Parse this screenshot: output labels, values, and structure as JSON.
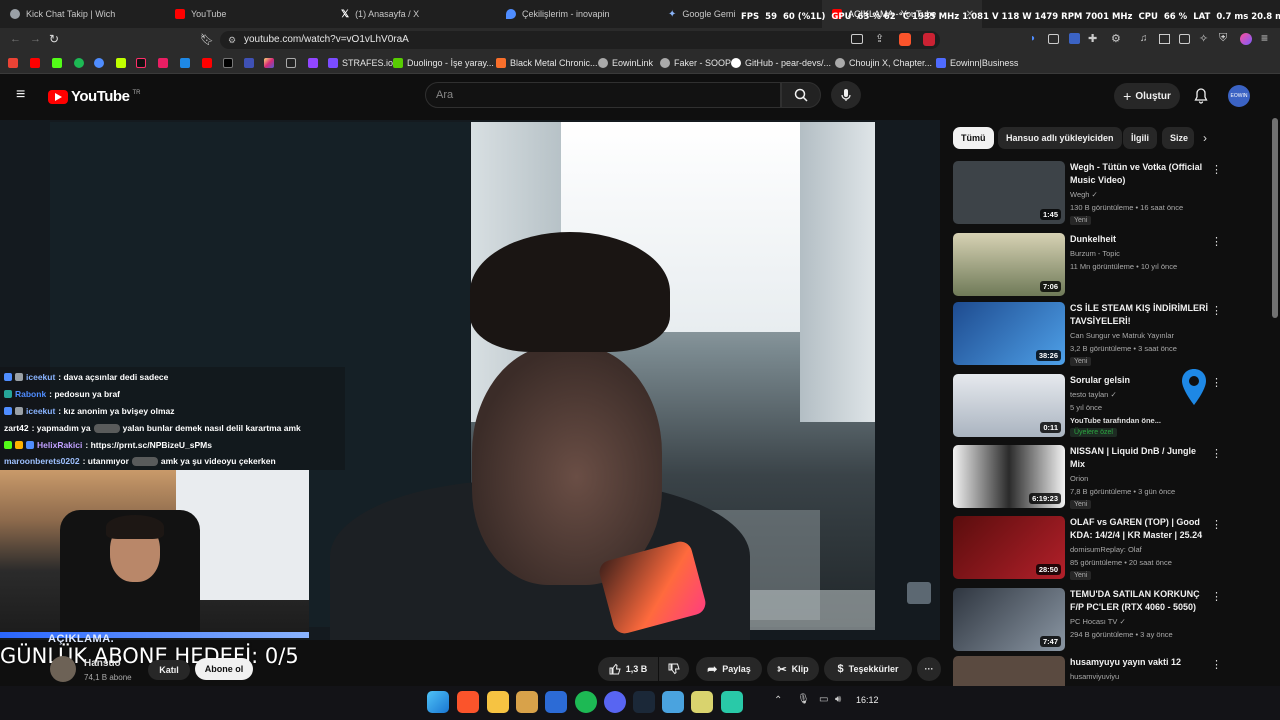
{
  "browser": {
    "tabs": [
      {
        "label": "Kick Chat Takip | Wich",
        "color": "#9aa0a6"
      },
      {
        "label": "YouTube",
        "color": "#ff0000"
      },
      {
        "label": "(1) Anasayfa / X",
        "color": "#ffffff"
      },
      {
        "label": "Çekilişlerim - inovapin",
        "color": "#4f8dff"
      },
      {
        "label": "Google Gemini",
        "color": "#8ab4f8"
      },
      {
        "label": "AÇIKLAMA - YouTube",
        "color": "#ff0000"
      }
    ],
    "url": "youtube.com/watch?v=vO1vLhV0raA",
    "bookmarks": [
      {
        "label": "STRAFES.io",
        "color": "#7b4cff"
      },
      {
        "label": "Duolingo - İşe yaray...",
        "color": "#58cc02"
      },
      {
        "label": "Black Metal Chronic...",
        "color": "#f96f2b"
      },
      {
        "label": "EowinLink",
        "color": "#cccccc"
      },
      {
        "label": "Faker - SOOP",
        "color": "#cccccc"
      },
      {
        "label": "GitHub - pear-devs/...",
        "color": "#ffffff"
      },
      {
        "label": "Choujin X, Chapter...",
        "color": "#cccccc"
      },
      {
        "label": "Eowinn|Business",
        "color": "#4f6bff"
      }
    ]
  },
  "overlay_stats": {
    "fps_label": "FPS",
    "fps": "59",
    "fps_pct": "60 (%1L)",
    "gpu_label": "GPU",
    "gpu": "63 % 62 °C 1935 MHz 1.081 V 118 W 1479 RPM 7001 MHz",
    "cpu_label": "CPU",
    "cpu": "66 %",
    "lat_label": "LAT",
    "lat": "0.7 ms 20.8 ms"
  },
  "header": {
    "logo": "YouTube",
    "logo_country": "TR",
    "search_placeholder": "Ara",
    "create_label": "Oluştur",
    "avatar_text": "EOWIN"
  },
  "chat": [
    {
      "user": "iceekut",
      "user_color": "#8ab4ff",
      "msg": ": dava açsınlar dedi sadece",
      "emote": false
    },
    {
      "user": "Rabonk",
      "user_color": "#4f8dff",
      "msg": ": pedosun ya braf",
      "emote": false
    },
    {
      "user": "iceekut",
      "user_color": "#8ab4ff",
      "msg": ": kız anonim ya bvişey olmaz",
      "emote": false
    },
    {
      "user": "zart42",
      "user_color": "#ffffff",
      "msg": ": yapmadım ya",
      "msg2": "yalan bunlar demek nasıl delil karartma amk",
      "emote": true
    },
    {
      "user": "HelixRakici",
      "user_color": "#c0a0ff",
      "msg": ": https://prnt.sc/NPBizeU_sPMs",
      "emote": false
    },
    {
      "user": "maroonberets0202",
      "user_color": "#9ec1ff",
      "msg": ": utanmıyor",
      "msg2": "amk ya şu videoyu çekerken",
      "emote": true
    }
  ],
  "webcam_note": "AÇIKLAMA.",
  "goal_text": "GÜNLÜK ABONE HEDEFİ: 0/5",
  "video_meta": {
    "channel": "Hansuo",
    "subs": "74,1 B abone",
    "join": "Katıl",
    "subscribe": "Abone ol",
    "likes": "1,3 B",
    "share": "Paylaş",
    "clip": "Klip",
    "thanks": "Teşekkürler",
    "more": "···"
  },
  "chips": [
    "Tümü",
    "Hansuo adlı yükleyiciden",
    "İlgili",
    "Size"
  ],
  "recommendations": [
    {
      "title": "Wegh - Tütün ve Votka (Official Music Video)",
      "channel": "Wegh ✓",
      "meta": "130 B görüntüleme • 16 saat önce",
      "badge": "Yeni",
      "duration": "1:45",
      "thumb": "#3d4348"
    },
    {
      "title": "Dunkelheit",
      "channel": "Burzum - Topic",
      "meta": "11 Mn görüntüleme • 10 yıl önce",
      "badge": "",
      "duration": "7:06",
      "thumb": "#8a8368"
    },
    {
      "title": "CS İLE STEAM KIŞ İNDİRİMLERİ TAVSİYELERİ!",
      "channel": "Can Sungur ve Matruk Yayınlar",
      "meta": "3,2 B görüntüleme • 3 saat önce",
      "badge": "Yeni",
      "duration": "38:26",
      "thumb": "#2c5fa8"
    },
    {
      "title": "Sorular gelsin",
      "channel": "testo taylan ✓",
      "meta": "5 yıl önce",
      "meta2": "YouTube tarafından öne...",
      "badge": "Üyelere özel",
      "duration": "0:11",
      "thumb": "#c9cfd6"
    },
    {
      "title": "NISSAN | Liquid DnB / Jungle Mix",
      "channel": "Orion",
      "meta": "7,8 B görüntüleme • 3 gün önce",
      "badge": "Yeni",
      "duration": "6:19:23",
      "thumb": "#d9d9d9"
    },
    {
      "title": "OLAF vs GAREN (TOP) | Good KDA: 14/2/4 | KR Master | 25.24",
      "channel": "domisumReplay: Olaf",
      "meta": "85 görüntüleme • 20 saat önce",
      "badge": "Yeni",
      "duration": "28:50",
      "thumb": "#8b1d1d"
    },
    {
      "title": "TEMU'DA SATILAN KORKUNÇ F/P PC'LER (RTX 4060 - 5050)",
      "channel": "PC Hocası TV ✓",
      "meta": "294 B görüntüleme • 3 ay önce",
      "badge": "",
      "duration": "7:47",
      "thumb": "#4a5057"
    },
    {
      "title": "husamyuyu yayın vakti 12",
      "channel": "husamviyuviyu",
      "meta": "",
      "badge": "",
      "duration": "",
      "thumb": "#5a4a40"
    }
  ],
  "taskbar": {
    "time": "16:12"
  }
}
